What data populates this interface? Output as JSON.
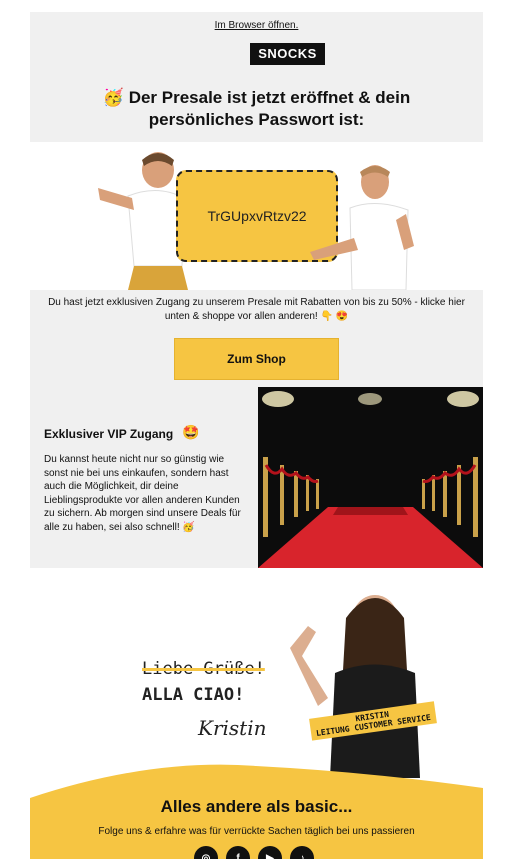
{
  "header": {
    "browser_link": "Im Browser öffnen.",
    "logo_text": "SNOCKS",
    "headline_emoji": "🥳",
    "headline": "Der Presale ist jetzt eröffnet & dein persönliches Passwort ist:"
  },
  "hero": {
    "password": "TrGUpxvRtzv22"
  },
  "intro": {
    "text": "Du hast jetzt exklusiven Zugang zu unserem Presale mit Rabatten von bis zu 50% - klicke hier unten & shoppe vor allen anderen! 👇 😍",
    "button_label": "Zum Shop"
  },
  "vip": {
    "title": "Exklusiver VIP Zugang",
    "title_emoji": "🤩",
    "text": "Du kannst heute nicht nur so günstig wie sonst nie bei uns einkaufen, sondern hast auch die Möglichkeit, dir deine Lieblingsprodukte vor allen anderen Kunden zu sichern. Ab morgen sind unsere Deals für alle zu haben, sei also schnell! 🥳"
  },
  "signoff": {
    "struck_text": "Liebe Grüße!",
    "ciao_text": "ALLA CIAO!",
    "signature": "Kristin",
    "badge_name": "KRISTIN",
    "badge_role": "LEITUNG CUSTOMER SERVICE"
  },
  "footer": {
    "title": "Alles andere als basic...",
    "subtitle": "Folge uns & erfahre was für verrückte Sachen täglich bei uns passieren",
    "socials": [
      "instagram-icon",
      "facebook-icon",
      "youtube-icon",
      "tiktok-icon"
    ]
  },
  "colors": {
    "accent": "#f6c542",
    "panel": "#f0f0f0",
    "dark": "#111111"
  }
}
